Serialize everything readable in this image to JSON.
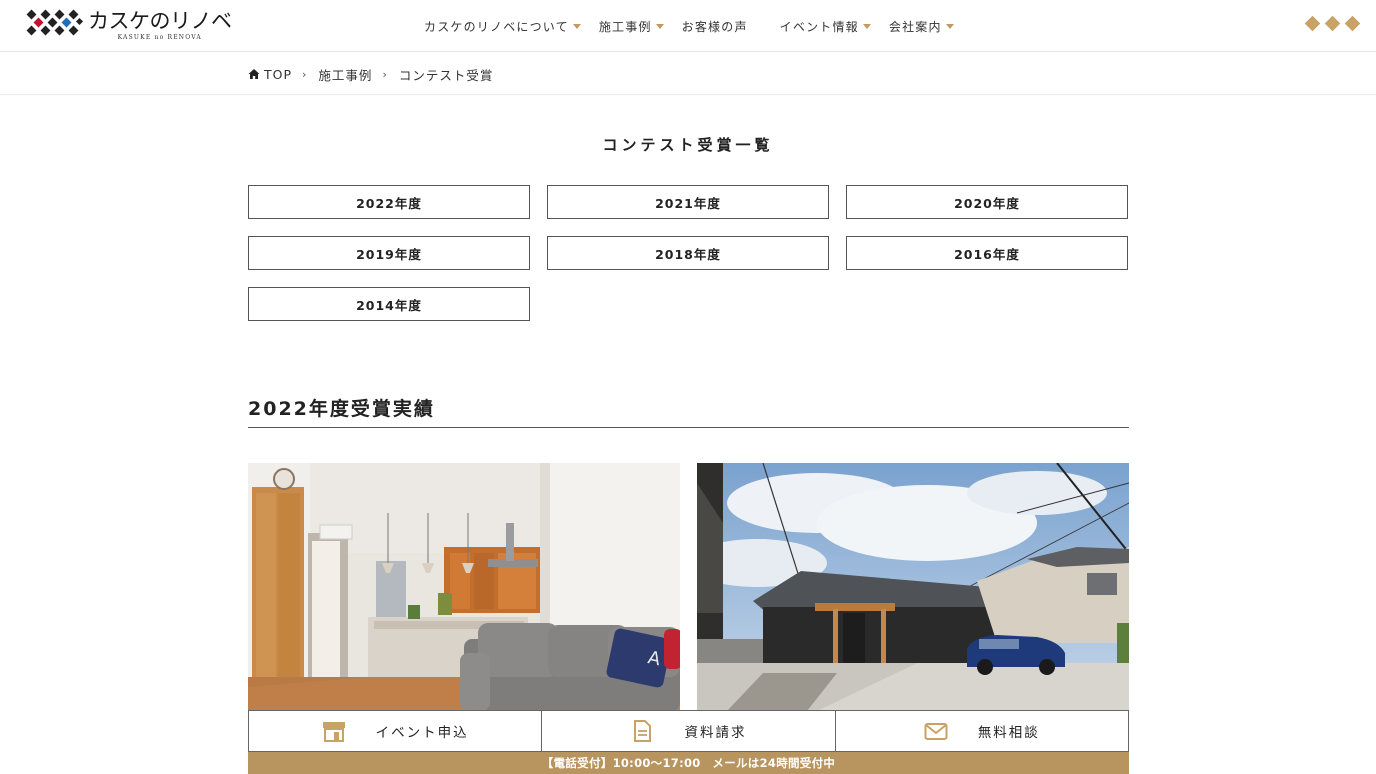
{
  "header": {
    "logo_name": "カスケのリノベ",
    "logo_sub": "KASUKE no RENOVA",
    "nav": [
      {
        "label": "カスケのリノベについて",
        "dropdown": true
      },
      {
        "label": "施工事例",
        "dropdown": true
      },
      {
        "label": "お客様の声",
        "dropdown": false
      },
      {
        "label": "イベント情報",
        "dropdown": true
      },
      {
        "label": "会社案内",
        "dropdown": true
      }
    ],
    "menu_icon": "diamond-dots-icon"
  },
  "breadcrumb": {
    "home": "TOP",
    "items": [
      "施工事例",
      "コンテスト受賞"
    ]
  },
  "main": {
    "title": "コンテスト受賞一覧",
    "years": [
      "2022年度",
      "2021年度",
      "2020年度",
      "2019年度",
      "2018年度",
      "2016年度",
      "2014年度"
    ],
    "section_heading": "2022年度受賞実績"
  },
  "footer_bar": {
    "event": "イベント申込",
    "docs": "資料請求",
    "consult": "無料相談",
    "tel_note": "【電話受付】10:00〜17:00　メールは24時間受付中"
  },
  "colors": {
    "accent": "#c39a5b",
    "bar": "#b8945e"
  }
}
